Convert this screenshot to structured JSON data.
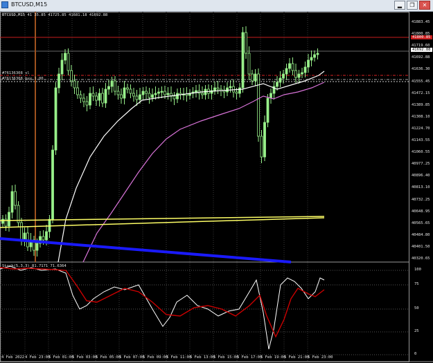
{
  "window": {
    "title": "BTCUSD,M15",
    "buttons": [
      "▂",
      "❐",
      "✕"
    ]
  },
  "chart": {
    "symbol_line": "BTCUSD,M15",
    "ohlc_line": "41  35.85 41725.85 41681.18 41692.88",
    "sell_order": "#76136308 sl",
    "buy_order": "#76136308 buy 1.00",
    "price_axis": [
      "41883.45",
      "41800.85",
      "41719.60",
      "41692.88",
      "41636.30",
      "41555.45",
      "41472.15",
      "41389.85",
      "41308.10",
      "41224.70",
      "41143.55",
      "41060.55",
      "40977.25",
      "40896.40",
      "40813.10",
      "40732.25",
      "40648.95",
      "40565.65",
      "40484.80",
      "40401.50",
      "40320.65"
    ],
    "price_tags": {
      "current": "41692.88",
      "red": "41800.85"
    },
    "time_axis": [
      "4 Feb 2022",
      "4 Feb 23:00",
      "5 Feb 01:00",
      "5 Feb 03:00",
      "5 Feb 05:00",
      "5 Feb 07:00",
      "5 Feb 09:00",
      "5 Feb 11:00",
      "5 Feb 13:00",
      "5 Feb 15:00",
      "5 Feb 17:00",
      "5 Feb 19:00",
      "5 Feb 21:00",
      "5 Feb 23:00"
    ],
    "stoch_header": "Stoch(5,3,3) 81.7171 71.6364",
    "stoch_axis": [
      "100",
      "75",
      "50",
      "25",
      "0"
    ],
    "colors": {
      "candles": "#98f08a",
      "ma_fast": "#ffffff",
      "ma_slow": "#d873d8",
      "yellow_line": "#ffff66",
      "blue_line": "#1a1aff",
      "stoch_main": "#ffffff",
      "stoch_signal": "#cc0000",
      "red_level": "#c81e1e"
    }
  }
}
